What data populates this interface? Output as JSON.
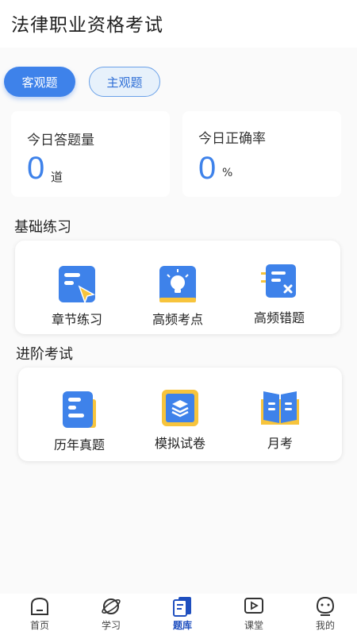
{
  "header": {
    "title": "法律职业资格考试"
  },
  "tabs": [
    {
      "label": "客观题",
      "active": true
    },
    {
      "label": "主观题",
      "active": false
    }
  ],
  "stats": {
    "today_count": {
      "label": "今日答题量",
      "value": "0",
      "unit": "道"
    },
    "today_accuracy": {
      "label": "今日正确率",
      "value": "0",
      "unit": "%"
    }
  },
  "basic": {
    "title": "基础练习",
    "items": [
      {
        "label": "章节练习",
        "icon": "chapter-practice-icon"
      },
      {
        "label": "高频考点",
        "icon": "lightbulb-icon"
      },
      {
        "label": "高频错题",
        "icon": "wrong-questions-icon"
      }
    ]
  },
  "advanced": {
    "title": "进阶考试",
    "items": [
      {
        "label": "历年真题",
        "icon": "past-papers-icon"
      },
      {
        "label": "模拟试卷",
        "icon": "mock-exam-icon"
      },
      {
        "label": "月考",
        "icon": "monthly-exam-book-icon"
      }
    ]
  },
  "nav": {
    "items": [
      {
        "label": "首页",
        "icon": "home-icon",
        "active": false
      },
      {
        "label": "学习",
        "icon": "planet-icon",
        "active": false
      },
      {
        "label": "题库",
        "icon": "question-bank-icon",
        "active": true
      },
      {
        "label": "课堂",
        "icon": "play-video-icon",
        "active": false
      },
      {
        "label": "我的",
        "icon": "profile-icon",
        "active": false
      }
    ]
  },
  "colors": {
    "accent": "#3e82ea",
    "accent_light": "#e7f1fb",
    "icon_yellow": "#f7c43c",
    "nav_active": "#1f4fbf"
  }
}
